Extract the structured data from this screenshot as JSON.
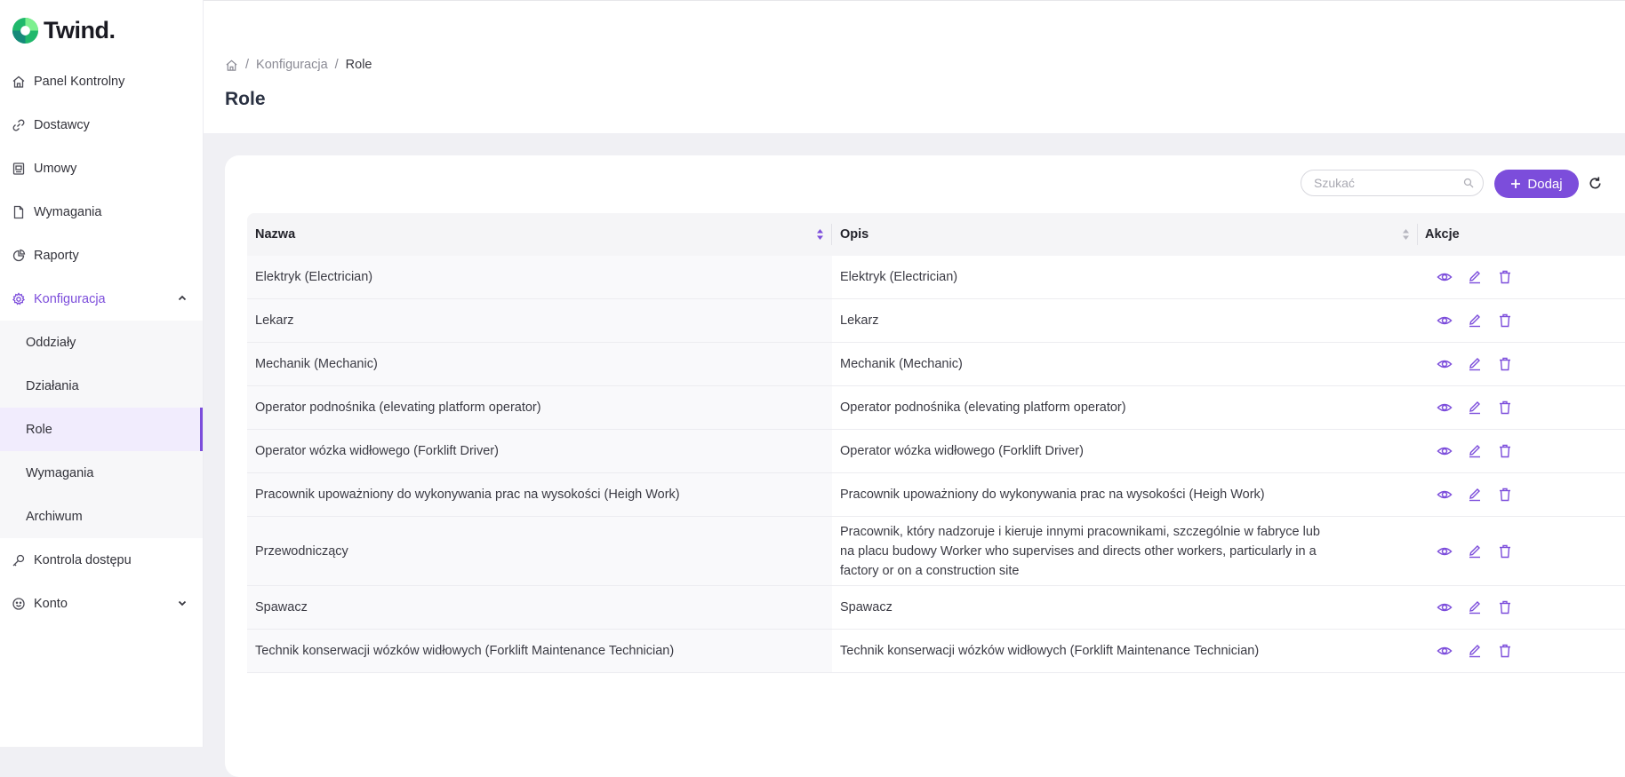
{
  "brand": {
    "name": "Twind."
  },
  "sidebar": {
    "items": [
      {
        "label": "Panel Kontrolny",
        "icon": "home-icon"
      },
      {
        "label": "Dostawcy",
        "icon": "link-icon"
      },
      {
        "label": "Umowy",
        "icon": "contract-icon"
      },
      {
        "label": "Wymagania",
        "icon": "document-icon"
      },
      {
        "label": "Raporty",
        "icon": "pie-chart-icon"
      },
      {
        "label": "Konfiguracja",
        "icon": "gear-icon",
        "expanded": true
      }
    ],
    "submenu": [
      {
        "label": "Oddziały"
      },
      {
        "label": "Działania"
      },
      {
        "label": "Role",
        "selected": true
      },
      {
        "label": "Wymagania"
      },
      {
        "label": "Archiwum"
      }
    ],
    "items_after": [
      {
        "label": "Kontrola dostępu",
        "icon": "key-icon"
      },
      {
        "label": "Konto",
        "icon": "smiley-icon"
      }
    ]
  },
  "breadcrumb": {
    "parent": "Konfiguracja",
    "current": "Role",
    "separator": "/"
  },
  "page": {
    "title": "Role"
  },
  "toolbar": {
    "search_placeholder": "Szukać",
    "add_label": "Dodaj"
  },
  "table": {
    "columns": {
      "name": "Nazwa",
      "description": "Opis",
      "actions": "Akcje"
    },
    "rows": [
      {
        "name": "Elektryk (Electrician)",
        "description": "Elektryk (Electrician)"
      },
      {
        "name": "Lekarz",
        "description": "Lekarz"
      },
      {
        "name": "Mechanik (Mechanic)",
        "description": "Mechanik (Mechanic)"
      },
      {
        "name": "Operator podnośnika (elevating platform operator)",
        "description": "Operator podnośnika (elevating platform operator)"
      },
      {
        "name": "Operator wózka widłowego (Forklift Driver)",
        "description": "Operator wózka widłowego (Forklift Driver)"
      },
      {
        "name": "Pracownik upoważniony do wykonywania prac na wysokości (Heigh Work)",
        "description": "Pracownik upoważniony do wykonywania prac na wysokości (Heigh Work)"
      },
      {
        "name": "Przewodniczący",
        "description": "Pracownik, który nadzoruje i kieruje innymi pracownikami, szczególnie w fabryce lub na placu budowy Worker who supervises and directs other workers, particularly in a factory or on a construction site"
      },
      {
        "name": "Spawacz",
        "description": "Spawacz"
      },
      {
        "name": "Technik konserwacji wózków widłowych (Forklift Maintenance Technician)",
        "description": "Technik konserwacji wózków widłowych (Forklift Maintenance Technician)"
      }
    ]
  },
  "colors": {
    "accent": "#7c4ddb",
    "logo_green": "#2bd46a",
    "logo_teal": "#1c8f8a"
  }
}
